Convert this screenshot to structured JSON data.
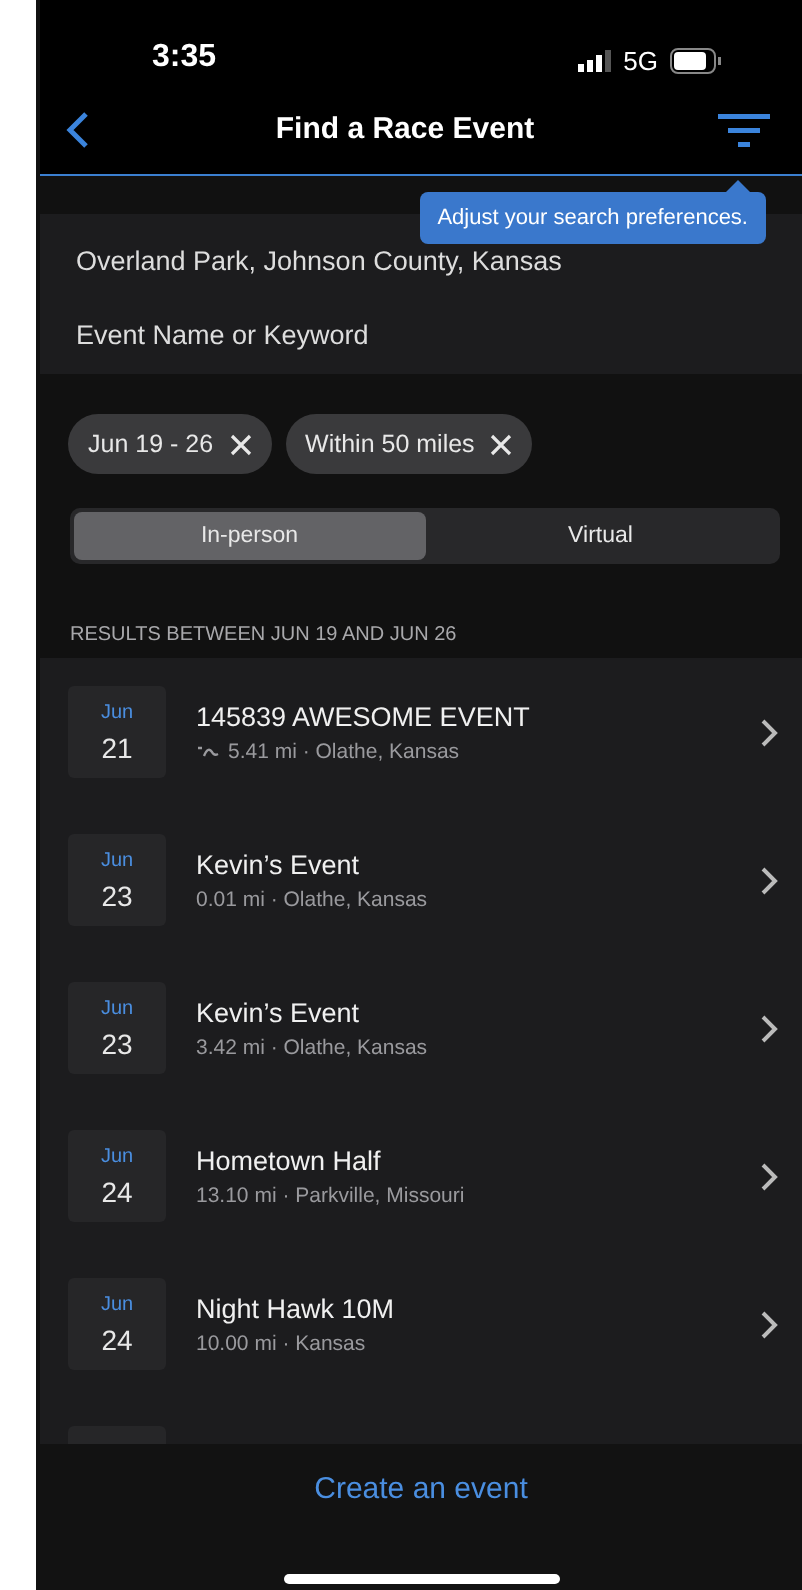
{
  "status_bar": {
    "time": "3:35",
    "network": "5G"
  },
  "nav": {
    "title": "Find a Race Event"
  },
  "tooltip": {
    "text": "Adjust your search preferences."
  },
  "search": {
    "location": "Overland Park, Johnson County, Kansas",
    "keyword_placeholder": "Event Name or Keyword"
  },
  "chips": [
    {
      "label": "Jun 19 - 26"
    },
    {
      "label": "Within 50 miles"
    }
  ],
  "segments": [
    {
      "label": "In-person",
      "selected": true
    },
    {
      "label": "Virtual",
      "selected": false
    }
  ],
  "results_header": "RESULTS BETWEEN JUN 19 AND JUN 26",
  "events": [
    {
      "month": "Jun",
      "day": "21",
      "title": "145839 AWESOME EVENT",
      "route_icon": true,
      "details": "5.41 mi · Olathe, Kansas"
    },
    {
      "month": "Jun",
      "day": "23",
      "title": "Kevin’s Event",
      "route_icon": false,
      "details": "0.01 mi · Olathe, Kansas"
    },
    {
      "month": "Jun",
      "day": "23",
      "title": "Kevin’s Event",
      "route_icon": false,
      "details": "3.42 mi · Olathe, Kansas"
    },
    {
      "month": "Jun",
      "day": "24",
      "title": "Hometown Half",
      "route_icon": false,
      "details": "13.10 mi · Parkville, Missouri"
    },
    {
      "month": "Jun",
      "day": "24",
      "title": "Night Hawk 10M",
      "route_icon": false,
      "details": "10.00 mi · Kansas"
    }
  ],
  "footer": {
    "action": "Create an event"
  }
}
